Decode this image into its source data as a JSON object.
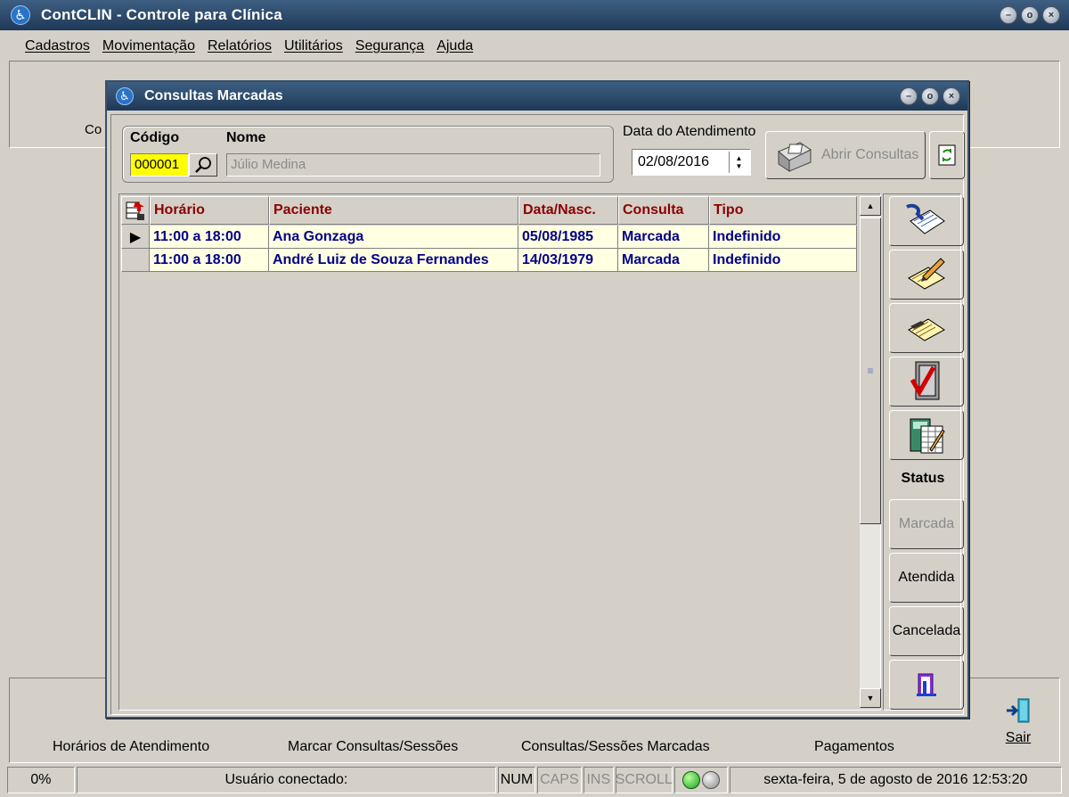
{
  "app": {
    "title": "ContCLIN - Controle para Clínica",
    "window_buttons": [
      "minimize",
      "restore",
      "close"
    ]
  },
  "menu": [
    "Cadastros",
    "Movimentação",
    "Relatórios",
    "Utilitários",
    "Segurança",
    "Ajuda"
  ],
  "top_panel": {
    "partial_label": "Co"
  },
  "bottom_shortcuts": {
    "horarios": "Horários de Atendimento",
    "marcar": "Marcar Consultas/Sessões",
    "consultas": "Consultas/Sessões Marcadas",
    "pagamentos": "Pagamentos",
    "sair": "Sair"
  },
  "statusbar": {
    "progress": "0%",
    "user": "Usuário conectado:",
    "num": "NUM",
    "caps": "CAPS",
    "ins": "INS",
    "scroll": "SCROLL",
    "datetime": "sexta-feira, 5 de agosto de 2016 12:53:20"
  },
  "dialog": {
    "title": "Consultas Marcadas",
    "codigo_label": "Código",
    "codigo_value": "000001",
    "nome_label": "Nome",
    "nome_value": "Júlio Medina",
    "data_label": "Data do Atendimento",
    "data_value": "02/08/2016",
    "abrir_label": "Abrir Consultas",
    "grid": {
      "columns": [
        "Horário",
        "Paciente",
        "Data/Nasc.",
        "Consulta",
        "Tipo"
      ],
      "rows": [
        [
          "11:00 a 18:00",
          "Ana Gonzaga",
          "05/08/1985",
          "Marcada",
          "Indefinido"
        ],
        [
          "11:00 a 18:00",
          "André Luiz de Souza Fernandes",
          "14/03/1979",
          "Marcada",
          "Indefinido"
        ]
      ]
    },
    "status_title": "Status",
    "status_buttons": {
      "marcada": "Marcada",
      "atendida": "Atendida",
      "cancelada": "Cancelada"
    }
  },
  "colors": {
    "titlebar": "#2d4a6a",
    "header_text": "#8b0000",
    "row_text": "#00008b",
    "row_bg": "#ffffe1",
    "code_bg": "#ffff00"
  }
}
